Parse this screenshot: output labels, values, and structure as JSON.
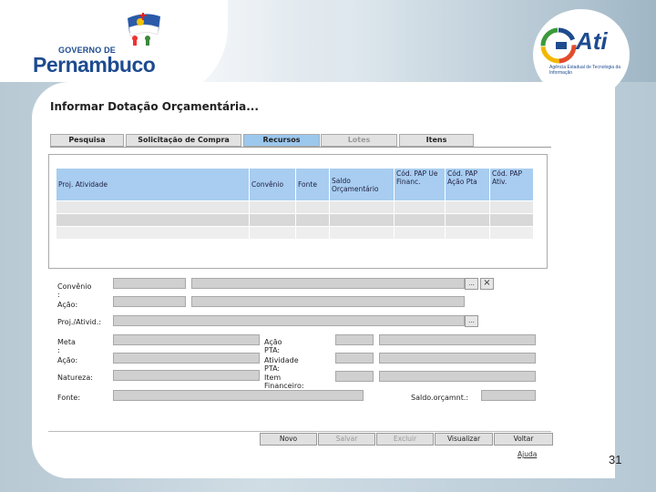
{
  "branding": {
    "gov_line": "GOVERNO DE",
    "state": "Pernambuco",
    "ati_name": "Ati",
    "ati_sub": "Agência Estadual de Tecnologia da Informação"
  },
  "screen": {
    "title": "Informar Dotação Orçamentária...",
    "tabs": [
      {
        "label": "Pesquisa",
        "state": "normal"
      },
      {
        "label": "Solicitação de Compra",
        "state": "normal"
      },
      {
        "label": "Recursos",
        "state": "active"
      },
      {
        "label": "Lotes",
        "state": "disabled"
      },
      {
        "label": "Itens",
        "state": "normal"
      }
    ],
    "grid": {
      "columns": [
        "Proj. Atividade",
        "Convênio",
        "Fonte",
        "Saldo Orçamentário",
        "Cód. PAP Ue Financ.",
        "Cód. PAP Ação Pta",
        "Cód. PAP Ativ."
      ],
      "rows": 3
    },
    "form": {
      "convenio_label": "Convênio :",
      "acao_label1": "Ação:",
      "proj_ativid_label": "Proj./Ativid.:",
      "meta_label": "Meta :",
      "acao_label2": "Ação:",
      "natureza_label": "Natureza:",
      "fonte_label": "Fonte:",
      "acao_pta_label": "Ação PTA:",
      "atividade_pta_label": "Atividade PTA:",
      "item_financeiro_label": "Item Financeiro:",
      "saldo_label": "Saldo.orçamnt.:",
      "lookup_icon": "...",
      "clear_icon": "×"
    },
    "buttons": [
      {
        "label": "Novo",
        "state": "normal"
      },
      {
        "label": "Salvar",
        "state": "disabled"
      },
      {
        "label": "Excluir",
        "state": "disabled"
      },
      {
        "label": "Visualizar",
        "state": "normal"
      },
      {
        "label": "Voltar",
        "state": "normal"
      }
    ],
    "help_link": "Ajuda"
  },
  "page_number": "31",
  "colors": {
    "tab_active": "#9cc8ee",
    "grid_header": "#a8cdf0",
    "brand_blue": "#1e4b8f"
  }
}
